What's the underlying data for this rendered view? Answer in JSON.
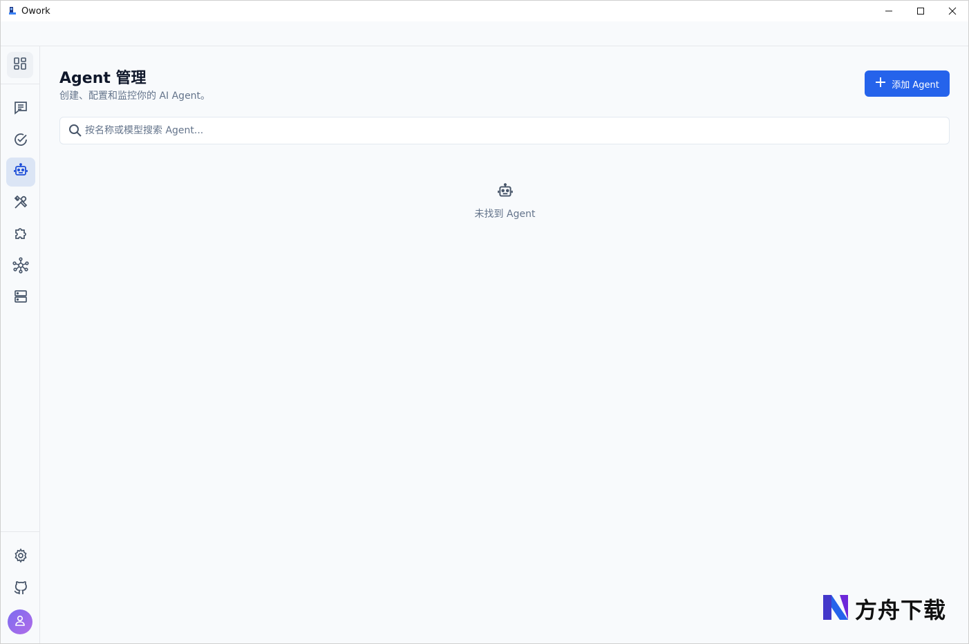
{
  "window": {
    "title": "Owork"
  },
  "sidebar": {
    "items": [
      {
        "name": "dashboard",
        "icon": "grid-icon"
      },
      {
        "name": "chat",
        "icon": "message-icon"
      },
      {
        "name": "tasks",
        "icon": "check-circle-icon"
      },
      {
        "name": "agents",
        "icon": "robot-icon",
        "active": true
      },
      {
        "name": "tools",
        "icon": "wrench-icon"
      },
      {
        "name": "plugins",
        "icon": "puzzle-icon"
      },
      {
        "name": "network",
        "icon": "network-icon"
      },
      {
        "name": "servers",
        "icon": "server-icon"
      }
    ],
    "bottom": [
      {
        "name": "settings",
        "icon": "gear-icon"
      },
      {
        "name": "github",
        "icon": "github-icon"
      },
      {
        "name": "profile",
        "icon": "user-icon"
      }
    ]
  },
  "main": {
    "title": "Agent 管理",
    "subtitle": "创建、配置和监控你的 AI Agent。",
    "add_button_label": "添加 Agent",
    "search": {
      "placeholder": "按名称或模型搜索 Agent...",
      "value": ""
    },
    "empty_text": "未找到 Agent"
  },
  "watermark": {
    "text": "方舟下载"
  },
  "colors": {
    "accent": "#2563eb",
    "active_bg": "#dbe5f5",
    "background": "#f8fafc"
  }
}
